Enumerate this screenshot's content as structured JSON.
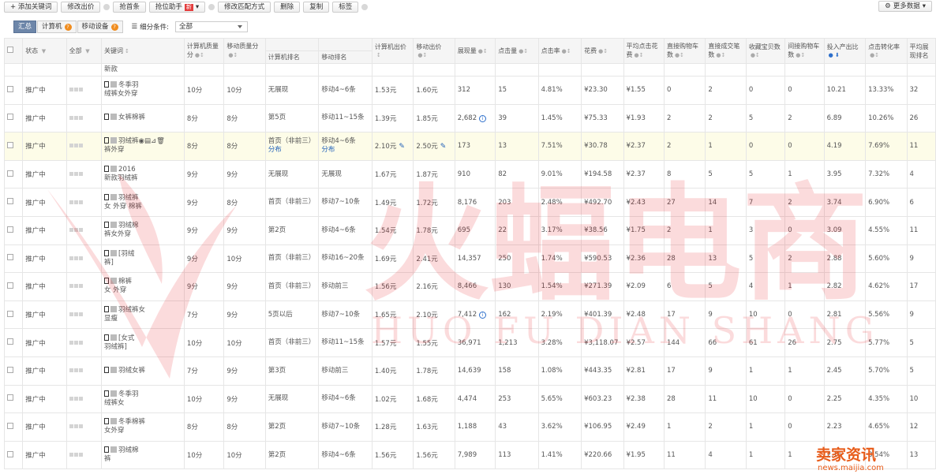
{
  "toolbar": {
    "add_keyword": "+ 添加关键词",
    "edit_bid": "修改出价",
    "grab_first": "抢首条",
    "grab_helper": "抢位助手",
    "new_badge": "新",
    "edit_match": "修改匹配方式",
    "delete": "删除",
    "copy": "复制",
    "tag": "标签",
    "more_data": "更多数据"
  },
  "filter": {
    "tabs": [
      {
        "label": "汇总"
      },
      {
        "label": "计算机",
        "badge": "?"
      },
      {
        "label": "移动设备",
        "badge": "?"
      }
    ],
    "condition_label": "细分条件:",
    "condition_value": "全部"
  },
  "headers": {
    "status": "状态",
    "all": "全部",
    "keyword": "关键词",
    "pc_quality": "计算机质量分",
    "mobile_quality": "移动质量分",
    "pc_rank": "计算机排名",
    "mobile_rank": "移动排名",
    "pc_bid": "计算机出价",
    "mobile_bid": "移动出价",
    "impressions": "展现量",
    "clicks": "点击量",
    "ctr": "点击率",
    "cost": "花费",
    "avg_cpc": "平均点击花费",
    "direct_cart": "直接购物车数",
    "direct_deal": "直接成交笔数",
    "fav_item": "收藏宝贝数",
    "indirect_cart": "间接购物车数",
    "roi": "投入产出比",
    "cvr": "点击转化率",
    "avg_rank": "平均展现排名"
  },
  "new_row_label": "新款",
  "rows": [
    {
      "status": "推广中",
      "kw1": "冬季羽",
      "kw2": "绒裤女外穿",
      "pcq": "10分",
      "mq": "10分",
      "pcr": "无展现",
      "mr": "移动4~6条",
      "pcb": "1.53元",
      "mb": "1.60元",
      "imp": "312",
      "clk": "15",
      "ctr": "4.81%",
      "cost": "¥23.30",
      "cpc": "¥1.55",
      "dc": "0",
      "dd": "2",
      "fav": "0",
      "ic": "0",
      "roi": "10.21",
      "cvr": "13.33%",
      "rank": "32"
    },
    {
      "status": "推广中",
      "kw1": "女裤棉裤",
      "kw2": "",
      "pcq": "8分",
      "mq": "8分",
      "pcr": "第5页",
      "mr": "移动11~15条",
      "pcb": "1.39元",
      "mb": "1.85元",
      "imp": "2,682",
      "clk": "39",
      "ctr": "1.45%",
      "cost": "¥75.33",
      "cpc": "¥1.93",
      "dc": "2",
      "dd": "2",
      "fav": "5",
      "ic": "2",
      "roi": "6.89",
      "cvr": "10.26%",
      "rank": "26"
    },
    {
      "status": "推广中",
      "kw1": "羽绒裤",
      "kw2": "裤外穿",
      "pcq": "8分",
      "mq": "8分",
      "pcr": "首页（非前三）",
      "pcr2": "分布",
      "mr": "移动4~6条",
      "mr2": "分布",
      "pcb": "2.10元",
      "mb": "2.50元",
      "imp": "173",
      "clk": "13",
      "ctr": "7.51%",
      "cost": "¥30.78",
      "cpc": "¥2.37",
      "dc": "2",
      "dd": "1",
      "fav": "0",
      "ic": "0",
      "roi": "4.19",
      "cvr": "7.69%",
      "rank": "11"
    },
    {
      "status": "推广中",
      "kw1": "2016",
      "kw2": "新款羽绒裤",
      "pcq": "9分",
      "mq": "9分",
      "pcr": "无展现",
      "mr": "无展现",
      "pcb": "1.67元",
      "mb": "1.87元",
      "imp": "910",
      "clk": "82",
      "ctr": "9.01%",
      "cost": "¥194.58",
      "cpc": "¥2.37",
      "dc": "8",
      "dd": "5",
      "fav": "5",
      "ic": "1",
      "roi": "3.95",
      "cvr": "7.32%",
      "rank": "4"
    },
    {
      "status": "推广中",
      "kw1": "羽绒裤",
      "kw2": "女 外穿 棉裤",
      "pcq": "9分",
      "mq": "8分",
      "pcr": "首页（非前三）",
      "mr": "移动7~10条",
      "pcb": "1.49元",
      "mb": "1.72元",
      "imp": "8,176",
      "clk": "203",
      "ctr": "2.48%",
      "cost": "¥492.70",
      "cpc": "¥2.43",
      "dc": "27",
      "dd": "14",
      "fav": "7",
      "ic": "2",
      "roi": "3.74",
      "cvr": "6.90%",
      "rank": "6"
    },
    {
      "status": "推广中",
      "kw1": "羽绒棉",
      "kw2": "裤女外穿",
      "pcq": "9分",
      "mq": "9分",
      "pcr": "第2页",
      "mr": "移动4~6条",
      "pcb": "1.54元",
      "mb": "1.78元",
      "imp": "695",
      "clk": "22",
      "ctr": "3.17%",
      "cost": "¥38.56",
      "cpc": "¥1.75",
      "dc": "2",
      "dd": "1",
      "fav": "3",
      "ic": "0",
      "roi": "3.09",
      "cvr": "4.55%",
      "rank": "11"
    },
    {
      "status": "推广中",
      "kw1": "[羽绒",
      "kw2": "裤]",
      "pcq": "9分",
      "mq": "10分",
      "pcr": "首页（非前三）",
      "mr": "移动16~20条",
      "pcb": "1.69元",
      "mb": "2.41元",
      "imp": "14,357",
      "clk": "250",
      "ctr": "1.74%",
      "cost": "¥590.53",
      "cpc": "¥2.36",
      "dc": "28",
      "dd": "13",
      "fav": "5",
      "ic": "2",
      "roi": "2.88",
      "cvr": "5.60%",
      "rank": "9"
    },
    {
      "status": "推广中",
      "kw1": "棉裤",
      "kw2": "女 外穿",
      "pcq": "9分",
      "mq": "9分",
      "pcr": "首页（非前三）",
      "mr": "移动前三",
      "pcb": "1.56元",
      "mb": "2.16元",
      "imp": "8,466",
      "clk": "130",
      "ctr": "1.54%",
      "cost": "¥271.39",
      "cpc": "¥2.09",
      "dc": "6",
      "dd": "5",
      "fav": "4",
      "ic": "1",
      "roi": "2.82",
      "cvr": "4.62%",
      "rank": "17"
    },
    {
      "status": "推广中",
      "kw1": "羽绒裤女",
      "kw2": "显瘦",
      "pcq": "7分",
      "mq": "9分",
      "pcr": "5页以后",
      "mr": "移动7~10条",
      "pcb": "1.65元",
      "mb": "2.10元",
      "imp": "7,412",
      "clk": "162",
      "ctr": "2.19%",
      "cost": "¥401.39",
      "cpc": "¥2.48",
      "dc": "17",
      "dd": "9",
      "fav": "10",
      "ic": "0",
      "roi": "2.81",
      "cvr": "5.56%",
      "rank": "9"
    },
    {
      "status": "推广中",
      "kw1": "[女式",
      "kw2": "羽绒裤]",
      "pcq": "10分",
      "mq": "10分",
      "pcr": "首页（非前三）",
      "mr": "移动11~15条",
      "pcb": "1.57元",
      "mb": "1.55元",
      "imp": "36,971",
      "clk": "1,213",
      "ctr": "3.28%",
      "cost": "¥3,118.07",
      "cpc": "¥2.57",
      "dc": "144",
      "dd": "66",
      "fav": "61",
      "ic": "26",
      "roi": "2.75",
      "cvr": "5.77%",
      "rank": "5"
    },
    {
      "status": "推广中",
      "kw1": "羽绒女裤",
      "kw2": "",
      "pcq": "7分",
      "mq": "9分",
      "pcr": "第3页",
      "mr": "移动前三",
      "pcb": "1.40元",
      "mb": "1.78元",
      "imp": "14,639",
      "clk": "158",
      "ctr": "1.08%",
      "cost": "¥443.35",
      "cpc": "¥2.81",
      "dc": "17",
      "dd": "9",
      "fav": "1",
      "ic": "1",
      "roi": "2.45",
      "cvr": "5.70%",
      "rank": "5"
    },
    {
      "status": "推广中",
      "kw1": "冬季羽",
      "kw2": "绒裤女",
      "pcq": "10分",
      "mq": "9分",
      "pcr": "无展现",
      "mr": "移动4~6条",
      "pcb": "1.02元",
      "mb": "1.68元",
      "imp": "4,474",
      "clk": "253",
      "ctr": "5.65%",
      "cost": "¥603.23",
      "cpc": "¥2.38",
      "dc": "28",
      "dd": "11",
      "fav": "10",
      "ic": "0",
      "roi": "2.25",
      "cvr": "4.35%",
      "rank": "10"
    },
    {
      "status": "推广中",
      "kw1": "冬季棉裤",
      "kw2": "女外穿",
      "pcq": "8分",
      "mq": "8分",
      "pcr": "第2页",
      "mr": "移动7~10条",
      "pcb": "1.28元",
      "mb": "1.63元",
      "imp": "1,188",
      "clk": "43",
      "ctr": "3.62%",
      "cost": "¥106.95",
      "cpc": "¥2.49",
      "dc": "1",
      "dd": "2",
      "fav": "1",
      "ic": "0",
      "roi": "2.23",
      "cvr": "4.65%",
      "rank": "12"
    },
    {
      "status": "推广中",
      "kw1": "羽绒棉",
      "kw2": "裤",
      "pcq": "10分",
      "mq": "10分",
      "pcr": "第2页",
      "mr": "移动4~6条",
      "pcb": "1.56元",
      "mb": "1.56元",
      "imp": "7,989",
      "clk": "113",
      "ctr": "1.41%",
      "cost": "¥220.66",
      "cpc": "¥1.95",
      "dc": "11",
      "dd": "4",
      "fav": "1",
      "ic": "1",
      "roi": "2.16",
      "cvr": "3.54%",
      "rank": "13"
    }
  ],
  "watermark": {
    "cn": "火蝠电商",
    "en": "HUO FU DIAN SHANG",
    "corner_cn": "卖家资讯",
    "corner_en": "news.maijia.com"
  },
  "colors": {
    "status_green": "#1c8c1c",
    "link_blue": "#1f5fb8",
    "watermark_red": "#e8242c",
    "corner_orange": "#e85c1a"
  }
}
